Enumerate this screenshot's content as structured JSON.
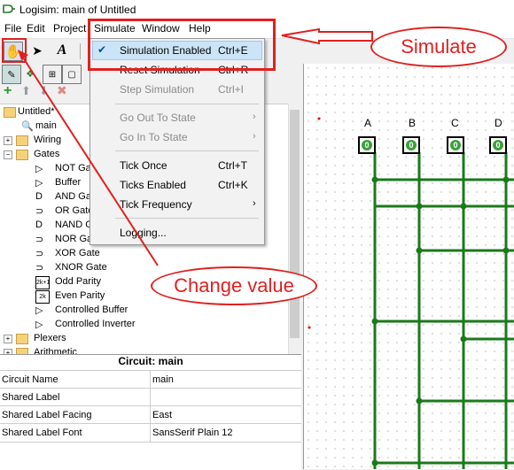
{
  "window": {
    "title": "Logisim: main of Untitled"
  },
  "menubar": [
    "File",
    "Edit",
    "Project",
    "Simulate",
    "Window",
    "Help"
  ],
  "simulate_menu": {
    "items": [
      {
        "label": "Simulation Enabled",
        "shortcut": "Ctrl+E",
        "checked": true,
        "enabled": true
      },
      {
        "label": "Reset Simulation",
        "shortcut": "Ctrl+R",
        "enabled": true
      },
      {
        "label": "Step Simulation",
        "shortcut": "Ctrl+I",
        "enabled": false
      },
      {
        "label": "Go Out To State",
        "enabled": false,
        "submenu": true
      },
      {
        "label": "Go In To State",
        "enabled": false,
        "submenu": true
      },
      {
        "label": "Tick Once",
        "shortcut": "Ctrl+T",
        "enabled": true
      },
      {
        "label": "Ticks Enabled",
        "shortcut": "Ctrl+K",
        "enabled": true
      },
      {
        "label": "Tick Frequency",
        "enabled": true,
        "submenu": true
      },
      {
        "label": "Logging...",
        "enabled": true
      }
    ]
  },
  "explorer": {
    "project": "Untitled*",
    "circuit": "main",
    "folders": [
      "Wiring",
      "Gates",
      "Plexers",
      "Arithmetic"
    ],
    "gates": [
      "NOT Gate",
      "Buffer",
      "AND Gate",
      "OR Gate",
      "NAND Gate",
      "NOR Gate",
      "XOR Gate",
      "XNOR Gate",
      "Odd Parity",
      "Even Parity",
      "Controlled Buffer",
      "Controlled Inverter"
    ]
  },
  "properties": {
    "title": "Circuit: main",
    "rows": [
      {
        "key": "Circuit Name",
        "value": "main"
      },
      {
        "key": "Shared Label",
        "value": ""
      },
      {
        "key": "Shared Label Facing",
        "value": "East"
      },
      {
        "key": "Shared Label Font",
        "value": "SansSerif Plain 12"
      }
    ]
  },
  "canvas": {
    "inputs": [
      {
        "label": "A",
        "value": "0"
      },
      {
        "label": "B",
        "value": "0"
      },
      {
        "label": "C",
        "value": "0"
      },
      {
        "label": "D",
        "value": "0"
      }
    ],
    "wire_color": "#1a7a1a"
  },
  "annotations": {
    "simulate": "Simulate",
    "change_value": "Change value",
    "color": "#e02020"
  },
  "icons": [
    "logisim-app-icon",
    "poke-hand-icon",
    "select-arrow-icon",
    "text-tool-icon",
    "add-icon",
    "move-up-icon",
    "move-down-icon",
    "delete-icon"
  ]
}
